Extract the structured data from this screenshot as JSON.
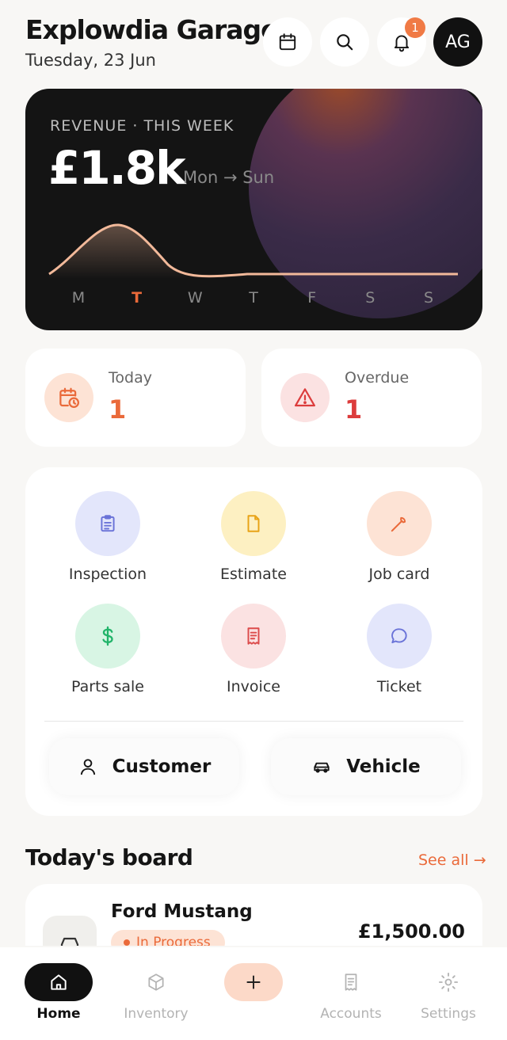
{
  "header": {
    "title": "Explowdia Garage",
    "date": "Tuesday, 23 Jun",
    "notification_count": "1",
    "avatar_initials": "AG",
    "icons": [
      "calendar-icon",
      "search-icon",
      "bell-icon"
    ]
  },
  "revenue": {
    "label": "REVENUE · THIS WEEK",
    "amount": "£1.8k",
    "range": "Mon → Sun",
    "days": [
      "M",
      "T",
      "W",
      "T",
      "F",
      "S",
      "S"
    ],
    "highlight_day_index": 1,
    "colors": {
      "line": "#f2b99a",
      "highlight": "#ea6a3a"
    }
  },
  "stats": {
    "today": {
      "label": "Today",
      "value": "1"
    },
    "overdue": {
      "label": "Overdue",
      "value": "1"
    }
  },
  "actions": [
    {
      "label": "Inspection",
      "icon": "clipboard-icon",
      "bg": "#e3e6fb",
      "color": "#6a73d8"
    },
    {
      "label": "Estimate",
      "icon": "document-icon",
      "bg": "#fdf0c2",
      "color": "#e8a317"
    },
    {
      "label": "Job card",
      "icon": "wrench-icon",
      "bg": "#fde3d5",
      "color": "#ea6a3a"
    },
    {
      "label": "Parts sale",
      "icon": "dollar-icon",
      "bg": "#d8f5e4",
      "color": "#22b46a"
    },
    {
      "label": "Invoice",
      "icon": "receipt-icon",
      "bg": "#fbe2e2",
      "color": "#dc4b4b"
    },
    {
      "label": "Ticket",
      "icon": "chat-bubble-icon",
      "bg": "#e3e6fb",
      "color": "#6a73d8"
    }
  ],
  "quick": {
    "customer": "Customer",
    "vehicle": "Vehicle"
  },
  "board": {
    "title": "Today's board",
    "see_all": "See all →",
    "jobs": [
      {
        "vehicle": "Ford Mustang",
        "status": "In Progress",
        "price": "£1,500.00"
      }
    ]
  },
  "nav": {
    "items": [
      {
        "label": "Home",
        "icon": "home-icon",
        "active": true
      },
      {
        "label": "Inventory",
        "icon": "box-icon",
        "active": false
      },
      {
        "label": "",
        "icon": "plus-icon",
        "active": false
      },
      {
        "label": "Accounts",
        "icon": "receipt-icon",
        "active": false
      },
      {
        "label": "Settings",
        "icon": "gear-icon",
        "active": false
      }
    ]
  }
}
